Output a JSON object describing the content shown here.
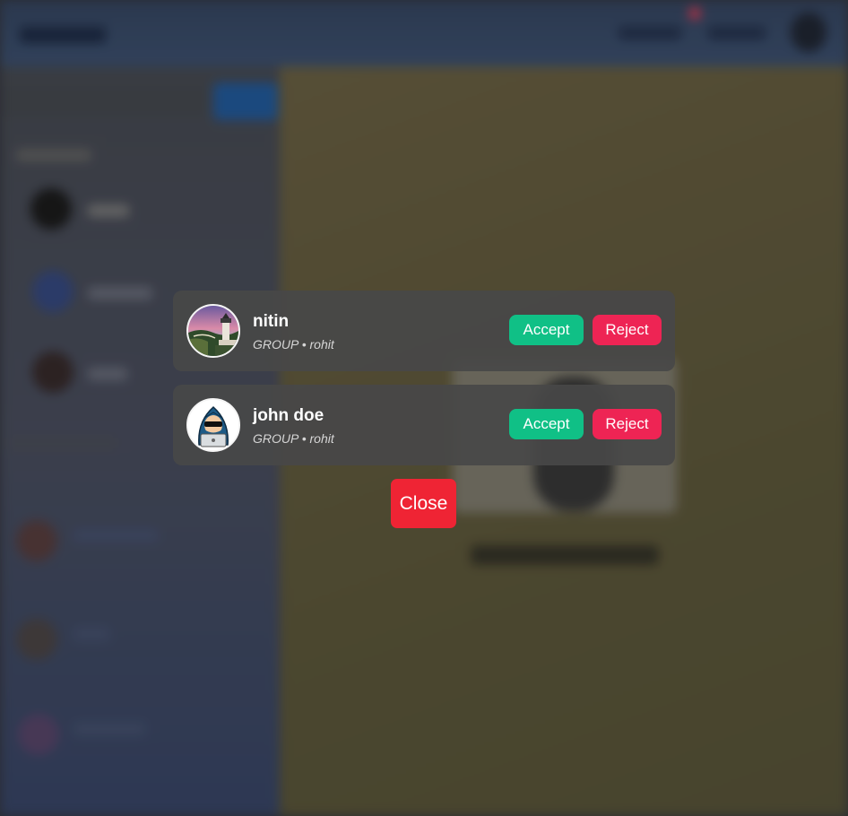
{
  "requests": [
    {
      "name": "nitin",
      "type": "GROUP",
      "separator": "•",
      "group": "rohit",
      "avatar": "lighthouse-photo"
    },
    {
      "name": "john doe",
      "type": "GROUP",
      "separator": "•",
      "group": "rohit",
      "avatar": "hooded-hacker-icon"
    }
  ],
  "actions": {
    "accept_label": "Accept",
    "reject_label": "Reject"
  },
  "modal": {
    "close_label": "Close"
  },
  "colors": {
    "accent_accept": "#10c086",
    "accent_reject": "#ee2454",
    "close": "#ef2434",
    "card": "#484848"
  }
}
